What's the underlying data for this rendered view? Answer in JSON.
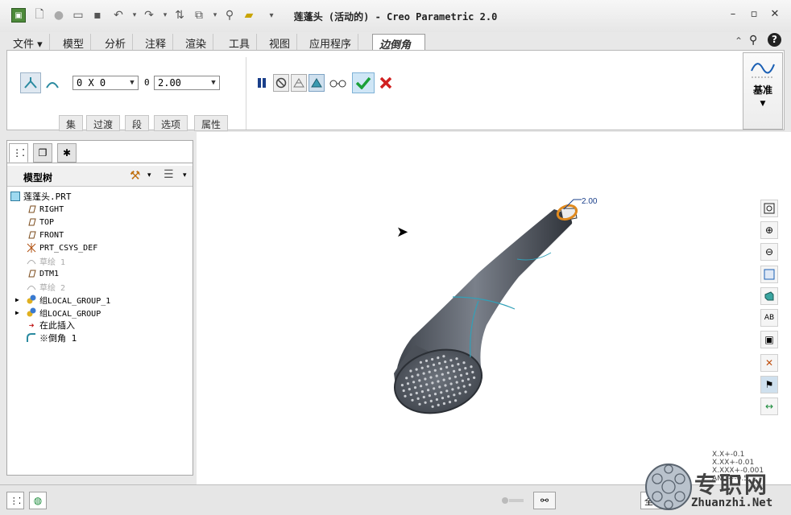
{
  "window": {
    "title": "莲蓬头 (活动的) - Creo Parametric 2.0"
  },
  "tabs": [
    {
      "label": "文件 ▾"
    },
    {
      "label": "模型"
    },
    {
      "label": "分析"
    },
    {
      "label": "注释"
    },
    {
      "label": "渲染"
    },
    {
      "label": "工具"
    },
    {
      "label": "视图"
    },
    {
      "label": "应用程序"
    },
    {
      "label": "边倒角"
    }
  ],
  "ribbon": {
    "set_value": "0 X 0",
    "radius_prefix": "0",
    "radius_value": "2.00",
    "subtabs": [
      "集",
      "过渡",
      "段",
      "选项",
      "属性"
    ],
    "datum_label": "基准"
  },
  "tree_panel": {
    "title": "模型树",
    "items": [
      {
        "label": "莲蓬头.PRT",
        "icon": "part-icon"
      },
      {
        "label": "RIGHT",
        "icon": "datum-plane-icon"
      },
      {
        "label": "TOP",
        "icon": "datum-plane-icon"
      },
      {
        "label": "FRONT",
        "icon": "datum-plane-icon"
      },
      {
        "label": "PRT_CSYS_DEF",
        "icon": "csys-icon"
      },
      {
        "label": "草绘 1",
        "icon": "sketch-icon"
      },
      {
        "label": "DTM1",
        "icon": "datum-plane-icon"
      },
      {
        "label": "草绘 2",
        "icon": "sketch-icon"
      },
      {
        "label": "组LOCAL_GROUP_1",
        "icon": "group-icon"
      },
      {
        "label": "组LOCAL_GROUP",
        "icon": "group-icon"
      },
      {
        "label": "在此插入",
        "icon": "insert-arrow-icon"
      },
      {
        "label": "※倒角 1",
        "icon": "round-icon"
      }
    ]
  },
  "viewport": {
    "dimension": "2.00"
  },
  "tolerance": [
    "X.X+-0.1",
    "X.XX+-0.01",
    "X.XXX+-0.001",
    "ANG+-0.5"
  ],
  "status": {
    "right_label": "全"
  },
  "watermark": {
    "cn": "专职网",
    "url": "Zhuanzhi.Net"
  },
  "colors": {
    "accent": "#1a5fb4",
    "model": "#585d66",
    "highlight": "#e08a1e",
    "confirm": "#1aa038",
    "cancel": "#d02020"
  }
}
